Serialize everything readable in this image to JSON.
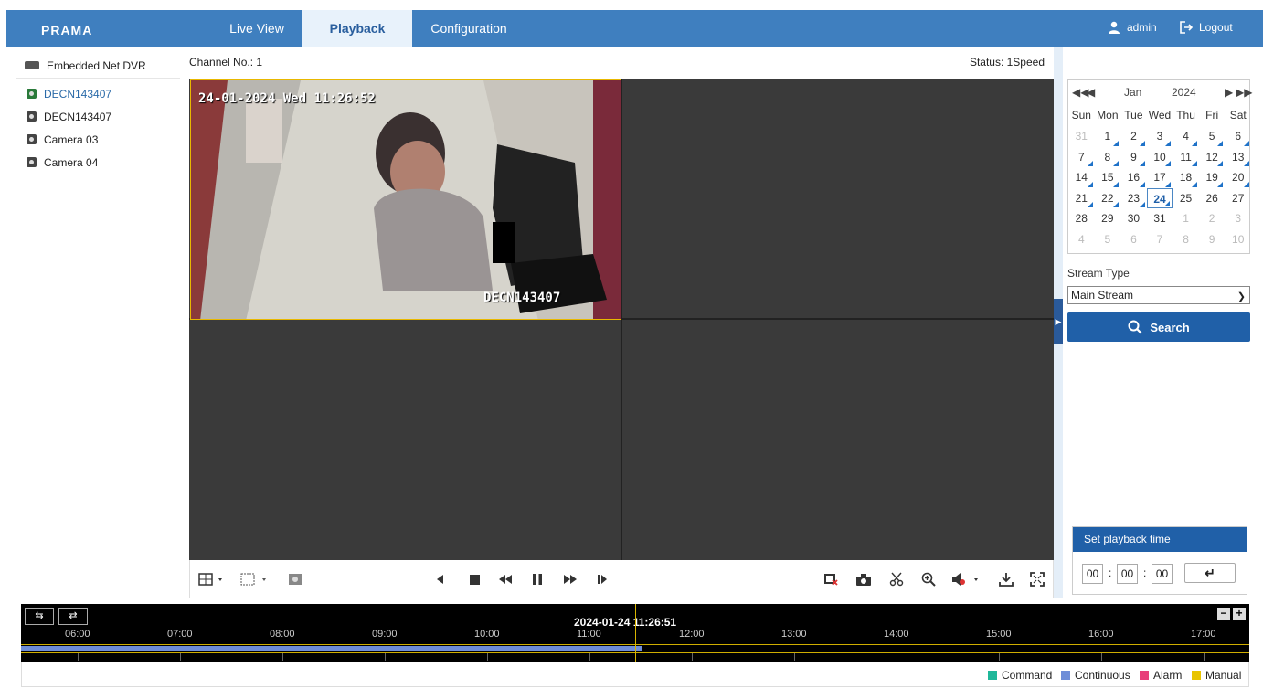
{
  "header": {
    "logo": "PRAMA",
    "tabs": [
      "Live View",
      "Playback",
      "Configuration"
    ],
    "user": "admin",
    "logout": "Logout"
  },
  "tree": {
    "root": "Embedded Net DVR",
    "channels": [
      "DECN143407",
      "DECN143407",
      "Camera 03",
      "Camera 04"
    ]
  },
  "video": {
    "channel_label": "Channel No.: 1",
    "status": "Status: 1Speed",
    "osd_time": "24-01-2024 Wed 11:26:52",
    "osd_name": "DECN143407"
  },
  "calendar": {
    "month": "Jan",
    "year": "2024",
    "weekdays": [
      "Sun",
      "Mon",
      "Tue",
      "Wed",
      "Thu",
      "Fri",
      "Sat"
    ],
    "days": [
      "31",
      "1",
      "2",
      "3",
      "4",
      "5",
      "6",
      "7",
      "8",
      "9",
      "10",
      "11",
      "12",
      "13",
      "14",
      "15",
      "16",
      "17",
      "18",
      "19",
      "20",
      "21",
      "22",
      "23",
      "24",
      "25",
      "26",
      "27",
      "28",
      "29",
      "30",
      "31",
      "1",
      "2",
      "3",
      "4",
      "5",
      "6",
      "7",
      "8",
      "9",
      "10"
    ],
    "selected": "24",
    "record_color": "#1f72c8"
  },
  "stream": {
    "label": "Stream Type",
    "value": "Main Stream"
  },
  "search": {
    "label": "Search"
  },
  "playback_time": {
    "title": "Set playback time",
    "hh": "00",
    "mm": "00",
    "ss": "00"
  },
  "timeline": {
    "current": "2024-01-24 11:26:51",
    "ticks": [
      "06:00",
      "07:00",
      "08:00",
      "09:00",
      "10:00",
      "11:00",
      "12:00",
      "13:00",
      "14:00",
      "15:00",
      "16:00",
      "17:00"
    ]
  },
  "legend": {
    "items": [
      {
        "label": "Command",
        "color": "#1fb89a"
      },
      {
        "label": "Continuous",
        "color": "#6f8ed8"
      },
      {
        "label": "Alarm",
        "color": "#e8407a"
      },
      {
        "label": "Manual",
        "color": "#e8c400"
      }
    ]
  }
}
